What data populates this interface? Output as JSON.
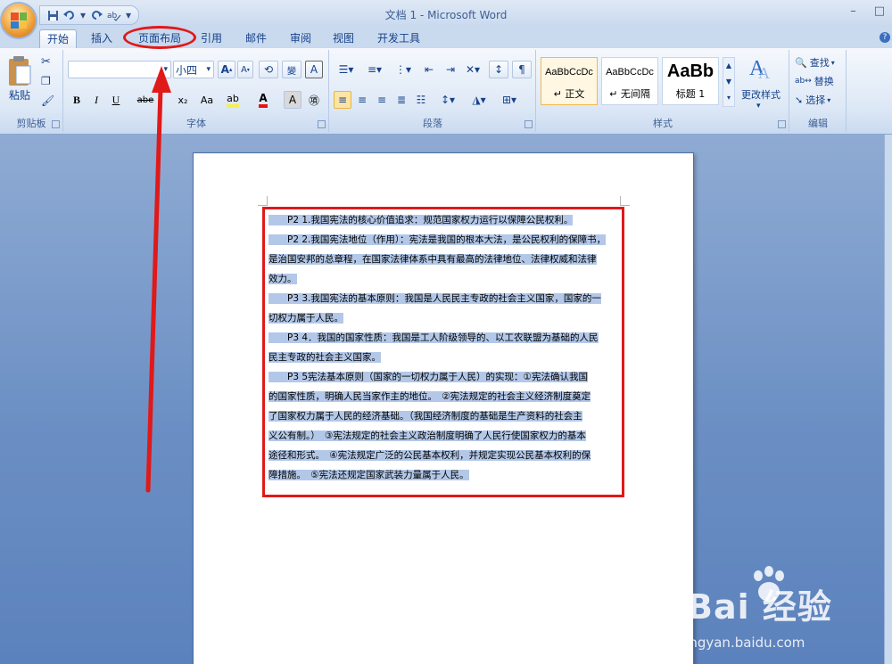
{
  "window": {
    "title": "文档 1 - Microsoft Word",
    "controls": [
      "–",
      "□"
    ]
  },
  "quick_access": {
    "icons": [
      "save-icon",
      "undo-icon",
      "redo-icon",
      "customize-icon"
    ]
  },
  "tabs": [
    {
      "label": "开始",
      "active": true
    },
    {
      "label": "插入"
    },
    {
      "label": "页面布局",
      "highlighted": true
    },
    {
      "label": "引用"
    },
    {
      "label": "邮件"
    },
    {
      "label": "审阅"
    },
    {
      "label": "视图"
    },
    {
      "label": "开发工具"
    }
  ],
  "ribbon": {
    "clipboard": {
      "group_label": "剪贴板",
      "paste_label": "粘贴"
    },
    "font": {
      "group_label": "字体",
      "font_name": "",
      "font_size": "小四",
      "row2_buttons": [
        "B",
        "I",
        "U",
        "abe",
        "x₂",
        "x²",
        "Aa"
      ],
      "grow_label": "A",
      "wen_label": "變",
      "border_char_label": "A"
    },
    "paragraph": {
      "group_label": "段落"
    },
    "styles": {
      "group_label": "样式",
      "items": [
        {
          "sample": "AaBbCcDc",
          "name": "↵ 正文"
        },
        {
          "sample": "AaBbCcDc",
          "name": "↵ 无间隔"
        },
        {
          "sample": "AaBb",
          "name": "标题 1"
        }
      ],
      "change_styles_label": "更改样式"
    },
    "editing": {
      "group_label": "编辑",
      "find_label": "查找",
      "replace_label": "替换",
      "select_label": "选择"
    }
  },
  "document": {
    "lines": [
      "　　P2 1.我国宪法的核心价值追求：规范国家权力运行以保障公民权利。",
      "　　P2 2.我国宪法地位（作用）：宪法是我国的根本大法，是公民权利的保障书，",
      "是治国安邦的总章程，在国家法律体系中具有最高的法律地位、法律权威和法律",
      "效力。",
      "　　P3 3.我国宪法的基本原则：我国是人民民主专政的社会主义国家，国家的一",
      "切权力属于人民。",
      "　　P3 4．我国的国家性质：我国是工人阶级领导的、以工农联盟为基础的人民",
      "民主专政的社会主义国家。",
      "　　P3 5宪法基本原则（国家的一切权力属于人民）的实现：①宪法确认我国",
      "的国家性质，明确人民当家作主的地位。　②宪法规定的社会主义经济制度奠定",
      "了国家权力属于人民的经济基础。（我国经济制度的基础是生产资料的社会主",
      "义公有制。）　③宪法规定的社会主义政治制度明确了人民行使国家权力的基本",
      "途径和形式。　④宪法规定广泛的公民基本权利，并规定实现公民基本权利的保",
      "障措施。　⑤宪法还规定国家武装力量属于人民。"
    ]
  },
  "watermark": {
    "brand": "Bai 经验",
    "url": "jingyan.baidu.com"
  },
  "colors": {
    "annotation": "#e01919",
    "selection": "#b3c8e8"
  }
}
